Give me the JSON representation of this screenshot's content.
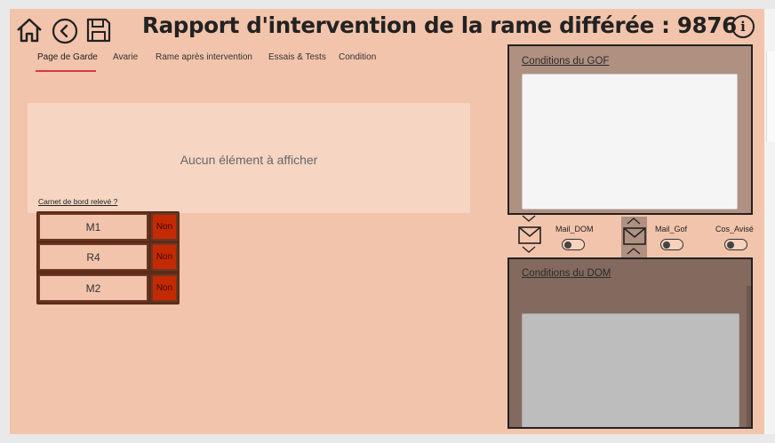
{
  "header": {
    "title": "Rapport d'intervention de la rame différée : 9876",
    "home_icon": "home-icon",
    "back_icon": "back-circle-icon",
    "save_icon": "save-disk-icon",
    "info_label": "i"
  },
  "tabs": [
    {
      "label": "Page de Garde",
      "active": true
    },
    {
      "label": "Avarie",
      "active": false
    },
    {
      "label": "Rame après intervention",
      "active": false
    },
    {
      "label": "Essais & Tests",
      "active": false
    },
    {
      "label": "Condition",
      "active": false
    }
  ],
  "main": {
    "empty_message": "Aucun élément à afficher",
    "carnet_label": "Carnet de bord relevé ?",
    "carnet_rows": [
      {
        "name": "M1",
        "value": "Non"
      },
      {
        "name": "R4",
        "value": "Non"
      },
      {
        "name": "M2",
        "value": "Non"
      }
    ]
  },
  "right": {
    "gof_title": "Conditions du GOF",
    "dom_title": "Conditions du DOM",
    "toggles": [
      {
        "label": "Mail_DOM",
        "on": false
      },
      {
        "label": "Mail_Gof",
        "on": false
      },
      {
        "label": "Cos_Avisé",
        "on": false
      }
    ]
  },
  "colors": {
    "background": "#f2c4ab",
    "accent_underline": "#d4384a",
    "status_no": "#c42a00",
    "gof_panel": "#b09080",
    "dom_panel": "#846a5e"
  }
}
